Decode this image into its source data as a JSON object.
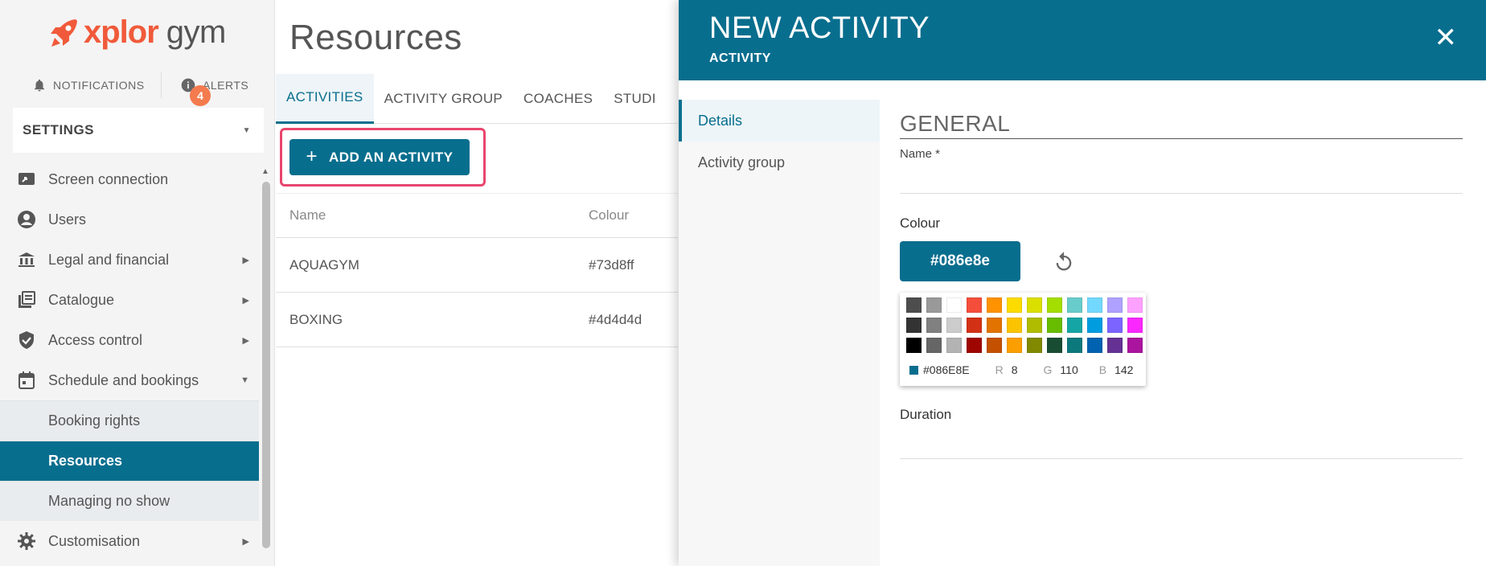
{
  "brand": {
    "name": "xplor",
    "suffix": "gym",
    "color": "#f05a3a"
  },
  "header": {
    "notifications_label": "NOTIFICATIONS",
    "alerts_label": "ALERTS",
    "alerts_count": "4"
  },
  "settings": {
    "label": "SETTINGS"
  },
  "sidebar": {
    "items": [
      {
        "label": "Screen connection",
        "icon": "screen-connection-icon"
      },
      {
        "label": "Users",
        "icon": "user-icon"
      },
      {
        "label": "Legal and financial",
        "icon": "bank-icon"
      },
      {
        "label": "Catalogue",
        "icon": "catalogue-icon"
      },
      {
        "label": "Access control",
        "icon": "shield-check-icon"
      },
      {
        "label": "Schedule and bookings",
        "icon": "calendar-icon"
      }
    ],
    "subitems": [
      {
        "label": "Booking rights"
      },
      {
        "label": "Resources"
      },
      {
        "label": "Managing no show"
      }
    ],
    "customisation": {
      "label": "Customisation",
      "icon": "gear-icon"
    }
  },
  "main": {
    "title": "Resources",
    "tabs": [
      "ACTIVITIES",
      "ACTIVITY GROUP",
      "COACHES",
      "STUDI"
    ],
    "add_button": "ADD AN ACTIVITY",
    "table": {
      "headers": [
        "Name",
        "Colour"
      ],
      "rows": [
        {
          "name": "AQUAGYM",
          "colour": "#73d8ff"
        },
        {
          "name": "BOXING",
          "colour": "#4d4d4d"
        }
      ]
    }
  },
  "drawer": {
    "title": "NEW ACTIVITY",
    "subtitle": "ACTIVITY",
    "nav": [
      "Details",
      "Activity group"
    ],
    "section": "GENERAL",
    "name_label": "Name *",
    "colour_label": "Colour",
    "colour_value": "#086e8e",
    "palette": {
      "hex": "#086E8E",
      "r_label": "R",
      "r": "8",
      "g_label": "G",
      "g": "110",
      "b_label": "B",
      "b": "142",
      "swatches": [
        "#4d4d4d",
        "#999999",
        "#ffffff",
        "#f44e3b",
        "#fe9200",
        "#fcdc00",
        "#dbdf00",
        "#a4dd00",
        "#68ccca",
        "#73d8ff",
        "#aea1ff",
        "#fda1ff",
        "#333333",
        "#808080",
        "#cccccc",
        "#d33115",
        "#e27300",
        "#fcc400",
        "#b0bc00",
        "#68bc00",
        "#16a5a5",
        "#009ce0",
        "#7b64ff",
        "#fa28ff",
        "#000000",
        "#666666",
        "#b3b3b3",
        "#9f0500",
        "#c45100",
        "#fb9e00",
        "#808900",
        "#194d33",
        "#0c797d",
        "#0062b1",
        "#653294",
        "#ab149e"
      ]
    },
    "duration_label": "Duration"
  },
  "colors": {
    "accent": "#086e8e",
    "highlight": "#e8456d",
    "badge": "#f37b4e"
  }
}
